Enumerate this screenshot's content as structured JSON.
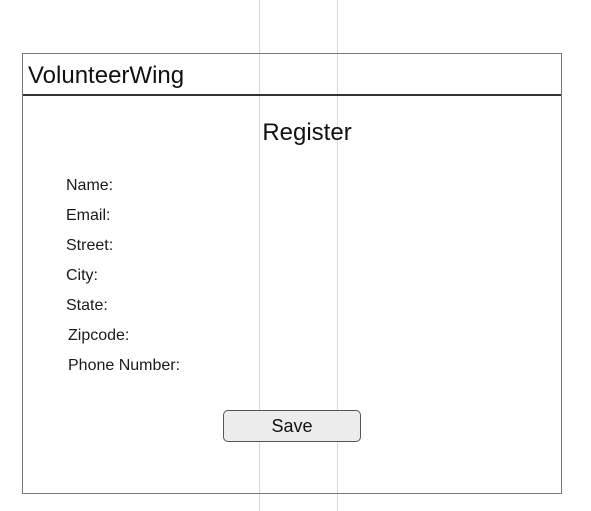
{
  "app": {
    "title": "VolunteerWing"
  },
  "page": {
    "title": "Register"
  },
  "form": {
    "labels": {
      "name": "Name:",
      "email": "Email:",
      "street": "Street:",
      "city": "City:",
      "state": "State:",
      "zipcode": "Zipcode:",
      "phone": "Phone Number:"
    },
    "save_label": "Save"
  }
}
